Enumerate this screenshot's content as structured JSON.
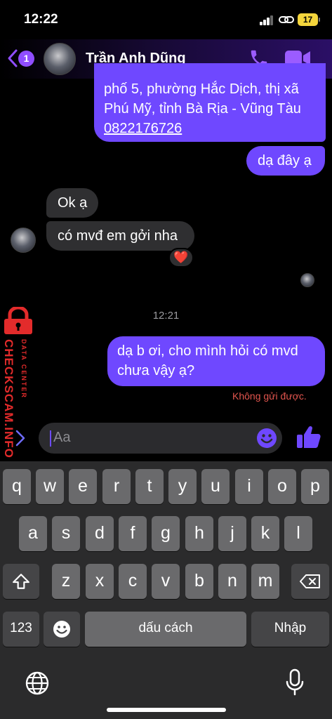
{
  "status_bar": {
    "time": "12:22",
    "battery": "17"
  },
  "header": {
    "back_badge": "1",
    "contact_name": "Trần Anh Dũng"
  },
  "messages": {
    "address_line1": "phố 5, phường Hắc Dịch, thị xã",
    "address_line2": "Phú Mỹ, tỉnh Bà Rịa - Vũng Tàu",
    "phone": "0822176726",
    "da_day": "dạ đây ạ",
    "ok": "Ok ạ",
    "mvd": "có mvđ em gởi nha",
    "reaction": "❤️",
    "timestamp": "12:21",
    "last_line1": "dạ b ơi, cho mình hỏi có mvd",
    "last_line2": "chưa vậy ạ?",
    "send_status": "Không gửi được."
  },
  "watermark": {
    "main": "CHECKSCAM.INFO",
    "sub": "DATA CENTER"
  },
  "composer": {
    "placeholder": "Aa"
  },
  "keyboard": {
    "row1": [
      "q",
      "w",
      "e",
      "r",
      "t",
      "y",
      "u",
      "i",
      "o",
      "p"
    ],
    "row2": [
      "a",
      "s",
      "d",
      "f",
      "g",
      "h",
      "j",
      "k",
      "l"
    ],
    "row3": [
      "z",
      "x",
      "c",
      "v",
      "b",
      "n",
      "m"
    ],
    "numbers": "123",
    "space": "dấu cách",
    "return": "Nhập"
  },
  "colors": {
    "accent": "#6f48ff",
    "incoming": "#2f2f31",
    "error": "#e2554e",
    "watermark": "#e32b2b"
  }
}
